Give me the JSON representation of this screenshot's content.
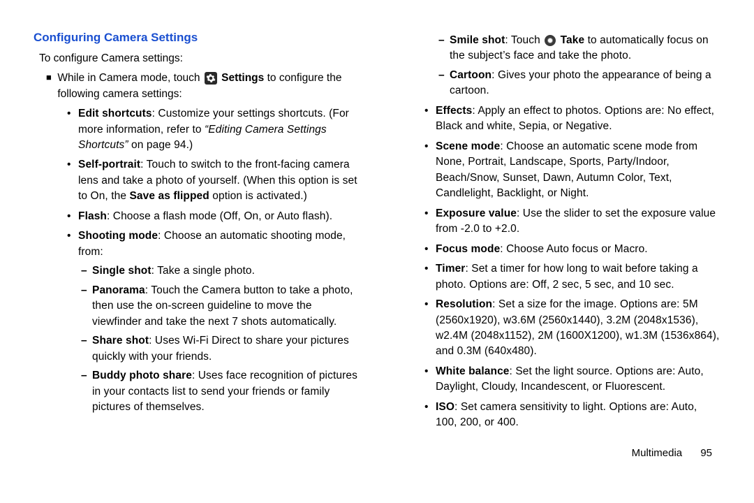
{
  "heading": "Configuring Camera Settings",
  "intro": "To configure Camera settings:",
  "main_bullet": {
    "pre": "While in Camera mode, touch ",
    "settings_label": "Settings",
    "post": " to configure the following camera settings:"
  },
  "left": {
    "edit_shortcuts_b": "Edit shortcuts",
    "edit_shortcuts_1": ": Customize your settings shortcuts. (For more information, refer to ",
    "edit_shortcuts_i": "“Editing Camera Settings Shortcuts”",
    "edit_shortcuts_2": " on page 94.)",
    "self_portrait_b": "Self-portrait",
    "self_portrait_1": ": Touch to switch to the front-facing camera lens and take a photo of yourself. (When this option is set to On, the ",
    "save_flipped_b": "Save as flipped",
    "self_portrait_2": " option is activated.)",
    "flash_b": "Flash",
    "flash_t": ": Choose a flash mode (Off, On, or Auto flash).",
    "shooting_b": "Shooting mode",
    "shooting_t": ": Choose an automatic shooting mode, from:",
    "single_b": "Single shot",
    "single_t": ": Take a single photo.",
    "panorama_b": "Panorama",
    "panorama_t": ": Touch the Camera button to take a photo, then use the on-screen guideline to move the viewfinder and take the next 7 shots automatically.",
    "share_b": "Share shot",
    "share_t": ": Uses Wi-Fi Direct to share your pictures quickly with your friends.",
    "buddy_b": "Buddy photo share",
    "buddy_t": ": Uses face recognition of pictures in your contacts list to send your friends or family pictures of themselves."
  },
  "right": {
    "smile_b": "Smile shot",
    "smile_1": ": Touch ",
    "smile_take": "Take",
    "smile_2": " to automatically focus on the subject’s face and take the photo.",
    "cartoon_b": "Cartoon",
    "cartoon_t": ": Gives your photo the appearance of being a cartoon.",
    "effects_b": "Effects",
    "effects_t": ": Apply an effect to photos. Options are: No effect, Black and white, Sepia, or Negative.",
    "scene_b": "Scene mode",
    "scene_t": ": Choose an automatic scene mode from None, Portrait, Landscape, Sports, Party/Indoor, Beach/Snow, Sunset, Dawn, Autumn Color, Text, Candlelight, Backlight, or Night.",
    "exposure_b": "Exposure value",
    "exposure_t": ": Use the slider to set the exposure value from -2.0 to +2.0.",
    "focus_b": "Focus mode",
    "focus_t": ": Choose Auto focus or Macro.",
    "timer_b": "Timer",
    "timer_t": ": Set a timer for how long to wait before taking a photo. Options are: Off, 2 sec, 5 sec, and 10 sec.",
    "resolution_b": "Resolution",
    "resolution_t": ": Set a size for the image. Options are: 5M (2560x1920), w3.6M (2560x1440), 3.2M (2048x1536), w2.4M (2048x1152), 2M (1600X1200), w1.3M (1536x864), and 0.3M (640x480).",
    "wb_b": "White balance",
    "wb_t": ": Set the light source. Options are: Auto, Daylight, Cloudy, Incandescent, or Fluorescent.",
    "iso_b": "ISO",
    "iso_t": ": Set camera sensitivity to light.  Options are: Auto, 100, 200, or 400."
  },
  "footer": {
    "section": "Multimedia",
    "page": "95"
  }
}
